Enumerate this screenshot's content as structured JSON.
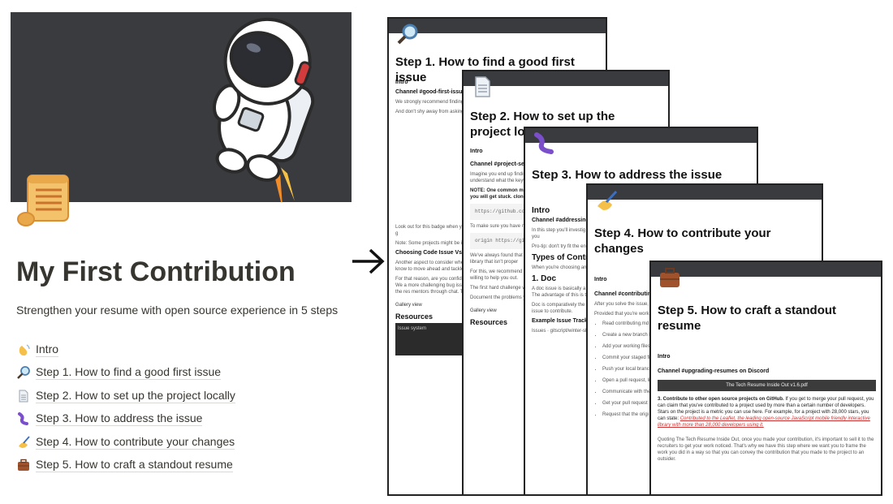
{
  "page": {
    "title": "My First Contribution",
    "subtitle": "Strengthen your resume with open source experience in 5 steps"
  },
  "toc": [
    {
      "label": "Intro",
      "icon": "waving-hand-icon"
    },
    {
      "label": "Step 1. How to find a good first issue",
      "icon": "magnifying-glass-icon"
    },
    {
      "label": "Step 2. How to set up the project locally",
      "icon": "document-icon"
    },
    {
      "label": "Step 3. How to address the issue",
      "icon": "worm-icon"
    },
    {
      "label": "Step 4. How to contribute your changes",
      "icon": "writing-hand-icon"
    },
    {
      "label": "Step 5. How to craft a standout resume",
      "icon": "briefcase-icon"
    }
  ],
  "cards": {
    "c1": {
      "title": "Step 1. How to find a good first issue",
      "intro": "Intro",
      "channel": "Channel #good-first-issues or",
      "p1": "We strongly recommend finding about. Don't be afraid to invest and projects out there!",
      "p2": "And don't shy away from asking happy to help you become a go tracker, or their channels (IRC/",
      "p3": "Look out for this badge when yo of it means they have an active you can solve problems if you g",
      "p4": "Note: Some projects might be in community and mentors if you'r",
      "h2": "Choosing Code Issue Vs. Doc",
      "p5": "Another aspect to consider whe is to see how we can get an iss get stuck without getting to know to move ahead and tackle even",
      "p6": "For that reason, are you confide of your choice? Then go for the worries, we got you covered. We a more challenging bug issue or workflows and tooling. You can c page to get started with the res mentors through chat. They'll be",
      "gallery": "Gallery view",
      "resources": "Resources",
      "issue_system": "Issue system"
    },
    "c2": {
      "title": "Step 2. How to set up the project locally",
      "intro": "Intro",
      "channel": "Channel #project-setup o",
      "p1": "Imagine you end up finding project up locally so that yo you'd need to have an idea understand what the keyw resources in the resources",
      "note": "NOTE: One common mist without making a fork of repository and make your hence you will get stuck. clone your version of it.",
      "code1": "https://github.com/",
      "p2": "To make sure you have no you can see your username",
      "code2": "origin https://githu origin https://githu",
      "p3": "We've always found that us projects and there are tech harder than the others. Som or a library that isn't proper",
      "p4": "For this, we recommend G run the Open-Source proje step thoroughly and have a are willing to help you out.",
      "p5": "The first hard challenge w and error, asking the comm comes your way as it acts a",
      "p6": "Document the problems yo comes across the same err",
      "gallery": "Gallery view",
      "resources": "Resources"
    },
    "c3": {
      "title": "Step 3. How to address the issue",
      "intro": "Intro",
      "channel": "Channel #addressing-is",
      "p1": "In this step you'll investig now set up correctly on y normal. Just keep at it an you're starting to lose you",
      "p2": "Pro-tip: don't try fit the en is to discard as much as",
      "h2": "Types of Contri",
      "p3": "When you're choosing an These are arranged in inc between them are and hu yourself even more.",
      "h3": "1. Doc",
      "p4": "A doc issue is basically a software. It can be editin was missing. Fixing typos feature. Most of the time, The advantage of this is t and you can just work to significant code changes",
      "p5": "Doc is comparatively the overwhelming at first to c the project up locally, an to first understand the wo issue to contribute.",
      "h4": "Example Issue Tracker",
      "issue": "Issues · gitscript/winter-sh",
      "gallery": "Gallery view",
      "resources": "Resources"
    },
    "c4": {
      "title": "Step 4. How to contribute your changes",
      "intro": "Intro",
      "channel": "Channel #contributing-c",
      "p1": "After you solve the issue, request. The maintainers It might take multiple itera",
      "p2": "Provided that you're work",
      "b1": "Read contributing.md",
      "b2": "Create a new branch bad habit.",
      "b3": "Add your working files",
      "b4": "Commit your staged fi",
      "b5": "Push your local branc",
      "b6": "Open a pull request, li PR gets merged.",
      "b7": "Communicate with the",
      "b8": "Get your pull request",
      "b9": "Request that the origi",
      "gallery": "Gallery view",
      "resources": "Resources"
    },
    "c5": {
      "title": "Step 5. How to craft a standout resume",
      "intro": "Intro",
      "channel": "Channel #upgrading-resumes on Discord",
      "pdf": "The Tech Resume Inside Out v1.6.pdf",
      "p1a": "3. Contribute to other open source projects on GitHub.",
      "p1b": " If you get to merge your pull request, you can claim that you've contributed to a project used by more than a certain number of developers. Stars on the project is a metric you can use here. For example, for a project with 28,000 stars, you can state: ",
      "p1c": "Contributed to the Leaflet, the leading open-source JavaScript mobile friendly interactive library with more than 28,000 developers using it.",
      "p2": "Quoting The Tech Resume Inside Out, once you made your contribution, it's important to sell it to the recruiters to get your work noticed. That's why we have this step where we want you to frame the work you did in a way so that you can convey the contribution that you made to the project to an outsider."
    }
  },
  "colors": {
    "cover": "#3a3b3f",
    "ink": "#37352f",
    "card_bar": "#3a3b3f"
  }
}
